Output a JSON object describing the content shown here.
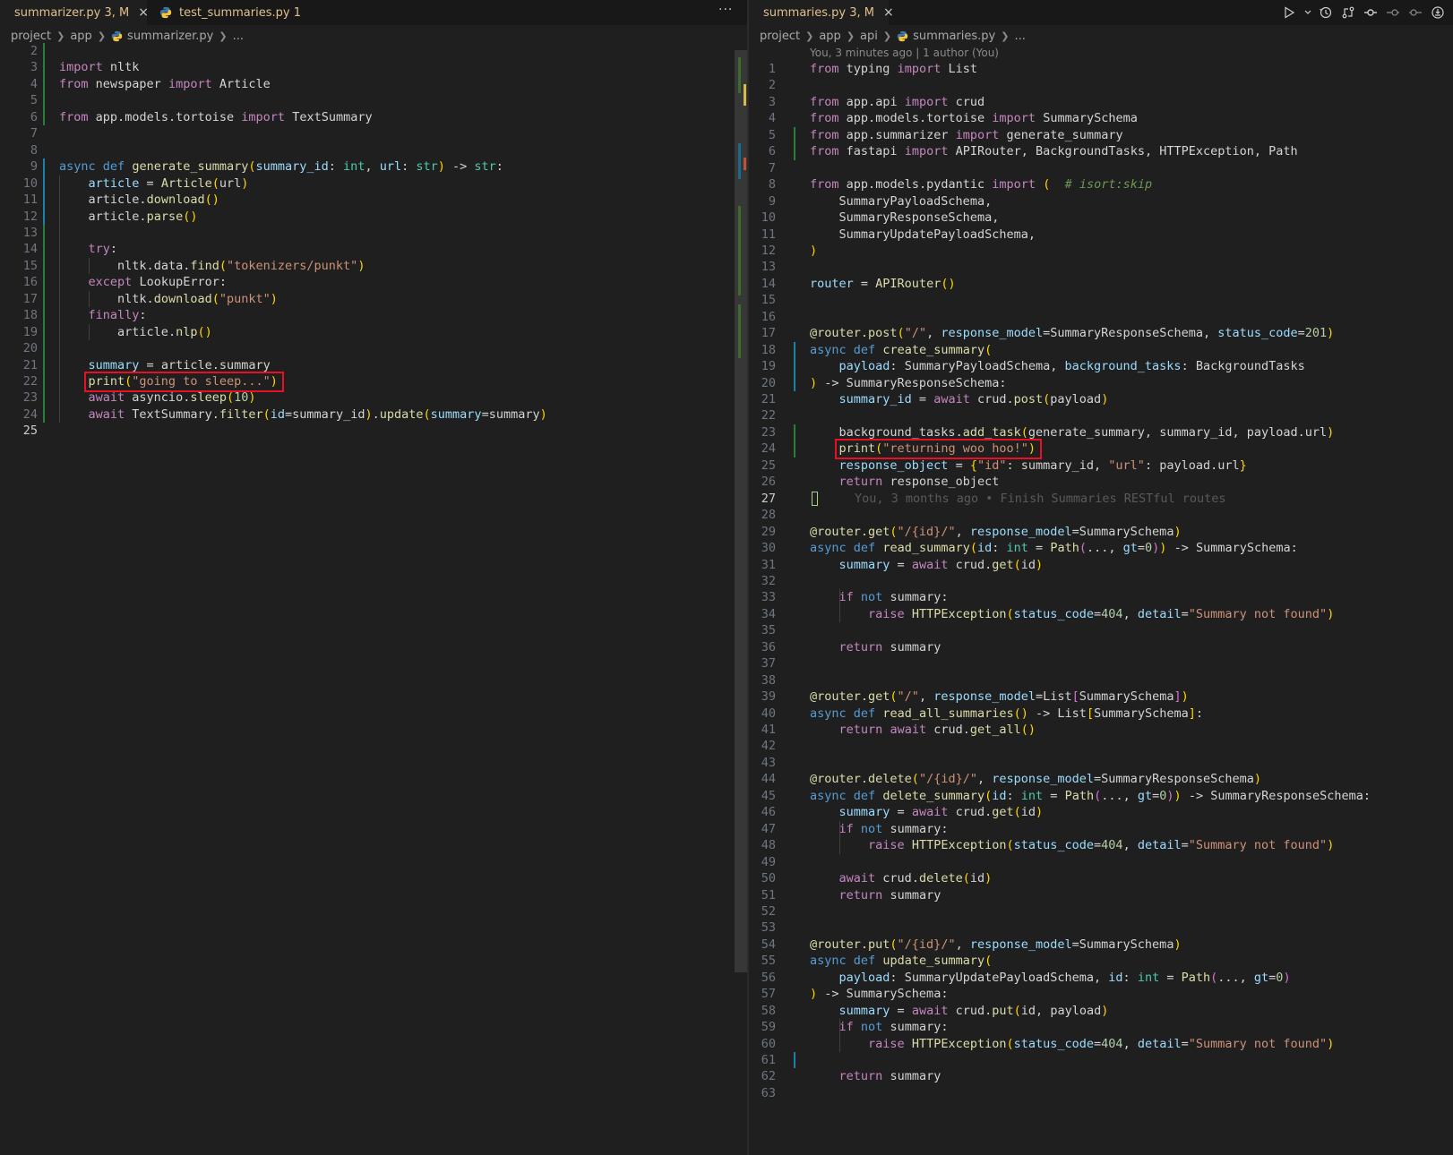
{
  "colors": {
    "background": "#1f1f1f",
    "tab_modified": "#e2c08d",
    "highlight_box": "#e81123",
    "gutter_added": "#2ea043",
    "gutter_modified": "#1b81a8"
  },
  "left_editor": {
    "tabs": [
      {
        "label": "summarizer.py 3, M",
        "icon": "python-icon",
        "close": "×",
        "active": true
      },
      {
        "label": "test_summaries.py 1",
        "icon": "python-icon",
        "active": false
      }
    ],
    "more_actions": "···",
    "breadcrumb": [
      "project",
      "app",
      "summarizer.py",
      "..."
    ],
    "active_line": "25",
    "highlighted_line": "22",
    "lines": [
      {
        "n": "2",
        "text": ""
      },
      {
        "n": "3",
        "text": "import nltk"
      },
      {
        "n": "4",
        "text": "from newspaper import Article"
      },
      {
        "n": "5",
        "text": ""
      },
      {
        "n": "6",
        "text": "from app.models.tortoise import TextSummary"
      },
      {
        "n": "7",
        "text": ""
      },
      {
        "n": "8",
        "text": ""
      },
      {
        "n": "9",
        "text": "async def generate_summary(summary_id: int, url: str) -> str:"
      },
      {
        "n": "10",
        "text": "    article = Article(url)"
      },
      {
        "n": "11",
        "text": "    article.download()"
      },
      {
        "n": "12",
        "text": "    article.parse()"
      },
      {
        "n": "13",
        "text": ""
      },
      {
        "n": "14",
        "text": "    try:"
      },
      {
        "n": "15",
        "text": "        nltk.data.find(\"tokenizers/punkt\")"
      },
      {
        "n": "16",
        "text": "    except LookupError:"
      },
      {
        "n": "17",
        "text": "        nltk.download(\"punkt\")"
      },
      {
        "n": "18",
        "text": "    finally:"
      },
      {
        "n": "19",
        "text": "        article.nlp()"
      },
      {
        "n": "20",
        "text": ""
      },
      {
        "n": "21",
        "text": "    summary = article.summary"
      },
      {
        "n": "22",
        "text": "    print(\"going to sleep...\")"
      },
      {
        "n": "23",
        "text": "    await asyncio.sleep(10)"
      },
      {
        "n": "24",
        "text": "    await TextSummary.filter(id=summary_id).update(summary=summary)"
      },
      {
        "n": "25",
        "text": ""
      }
    ]
  },
  "right_editor": {
    "tabs": [
      {
        "label": "summaries.py 3, M",
        "icon": "python-icon",
        "close": "×",
        "active": true
      }
    ],
    "toolbar_icons": [
      "run-icon",
      "dropdown-chevron-icon",
      "timeline-icon",
      "compare-changes-icon",
      "git-commit-icon",
      "previous-change-icon",
      "next-change-icon",
      "blame-toggle-icon"
    ],
    "breadcrumb": [
      "project",
      "app",
      "api",
      "summaries.py",
      "..."
    ],
    "blame_header": "You, 3 minutes ago | 1 author (You)",
    "inline_blame": "You, 3 months ago • Finish Summaries RESTful routes",
    "active_line": "27",
    "highlighted_line": "24",
    "lines": [
      {
        "n": "1",
        "text": "from typing import List"
      },
      {
        "n": "2",
        "text": ""
      },
      {
        "n": "3",
        "text": "from app.api import crud"
      },
      {
        "n": "4",
        "text": "from app.models.tortoise import SummarySchema"
      },
      {
        "n": "5",
        "text": "from app.summarizer import generate_summary"
      },
      {
        "n": "6",
        "text": "from fastapi import APIRouter, BackgroundTasks, HTTPException, Path"
      },
      {
        "n": "7",
        "text": ""
      },
      {
        "n": "8",
        "text": "from app.models.pydantic import (  # isort:skip"
      },
      {
        "n": "9",
        "text": "    SummaryPayloadSchema,"
      },
      {
        "n": "10",
        "text": "    SummaryResponseSchema,"
      },
      {
        "n": "11",
        "text": "    SummaryUpdatePayloadSchema,"
      },
      {
        "n": "12",
        "text": ")"
      },
      {
        "n": "13",
        "text": ""
      },
      {
        "n": "14",
        "text": "router = APIRouter()"
      },
      {
        "n": "15",
        "text": ""
      },
      {
        "n": "16",
        "text": ""
      },
      {
        "n": "17",
        "text": "@router.post(\"/\", response_model=SummaryResponseSchema, status_code=201)"
      },
      {
        "n": "18",
        "text": "async def create_summary("
      },
      {
        "n": "19",
        "text": "    payload: SummaryPayloadSchema, background_tasks: BackgroundTasks"
      },
      {
        "n": "20",
        "text": ") -> SummaryResponseSchema:"
      },
      {
        "n": "21",
        "text": "    summary_id = await crud.post(payload)"
      },
      {
        "n": "22",
        "text": ""
      },
      {
        "n": "23",
        "text": "    background_tasks.add_task(generate_summary, summary_id, payload.url)"
      },
      {
        "n": "24",
        "text": "    print(\"returning woo hoo!\")"
      },
      {
        "n": "25",
        "text": "    response_object = {\"id\": summary_id, \"url\": payload.url}"
      },
      {
        "n": "26",
        "text": "    return response_object"
      },
      {
        "n": "27",
        "text": ""
      },
      {
        "n": "28",
        "text": ""
      },
      {
        "n": "29",
        "text": "@router.get(\"/{id}/\", response_model=SummarySchema)"
      },
      {
        "n": "30",
        "text": "async def read_summary(id: int = Path(..., gt=0)) -> SummarySchema:"
      },
      {
        "n": "31",
        "text": "    summary = await crud.get(id)"
      },
      {
        "n": "32",
        "text": ""
      },
      {
        "n": "33",
        "text": "    if not summary:"
      },
      {
        "n": "34",
        "text": "        raise HTTPException(status_code=404, detail=\"Summary not found\")"
      },
      {
        "n": "35",
        "text": ""
      },
      {
        "n": "36",
        "text": "    return summary"
      },
      {
        "n": "37",
        "text": ""
      },
      {
        "n": "38",
        "text": ""
      },
      {
        "n": "39",
        "text": "@router.get(\"/\", response_model=List[SummarySchema])"
      },
      {
        "n": "40",
        "text": "async def read_all_summaries() -> List[SummarySchema]:"
      },
      {
        "n": "41",
        "text": "    return await crud.get_all()"
      },
      {
        "n": "42",
        "text": ""
      },
      {
        "n": "43",
        "text": ""
      },
      {
        "n": "44",
        "text": "@router.delete(\"/{id}/\", response_model=SummaryResponseSchema)"
      },
      {
        "n": "45",
        "text": "async def delete_summary(id: int = Path(..., gt=0)) -> SummaryResponseSchema:"
      },
      {
        "n": "46",
        "text": "    summary = await crud.get(id)"
      },
      {
        "n": "47",
        "text": "    if not summary:"
      },
      {
        "n": "48",
        "text": "        raise HTTPException(status_code=404, detail=\"Summary not found\")"
      },
      {
        "n": "49",
        "text": ""
      },
      {
        "n": "50",
        "text": "    await crud.delete(id)"
      },
      {
        "n": "51",
        "text": "    return summary"
      },
      {
        "n": "52",
        "text": ""
      },
      {
        "n": "53",
        "text": ""
      },
      {
        "n": "54",
        "text": "@router.put(\"/{id}/\", response_model=SummarySchema)"
      },
      {
        "n": "55",
        "text": "async def update_summary("
      },
      {
        "n": "56",
        "text": "    payload: SummaryUpdatePayloadSchema, id: int = Path(..., gt=0)"
      },
      {
        "n": "57",
        "text": ") -> SummarySchema:"
      },
      {
        "n": "58",
        "text": "    summary = await crud.put(id, payload)"
      },
      {
        "n": "59",
        "text": "    if not summary:"
      },
      {
        "n": "60",
        "text": "        raise HTTPException(status_code=404, detail=\"Summary not found\")"
      },
      {
        "n": "61",
        "text": ""
      },
      {
        "n": "62",
        "text": "    return summary"
      },
      {
        "n": "63",
        "text": ""
      }
    ]
  }
}
